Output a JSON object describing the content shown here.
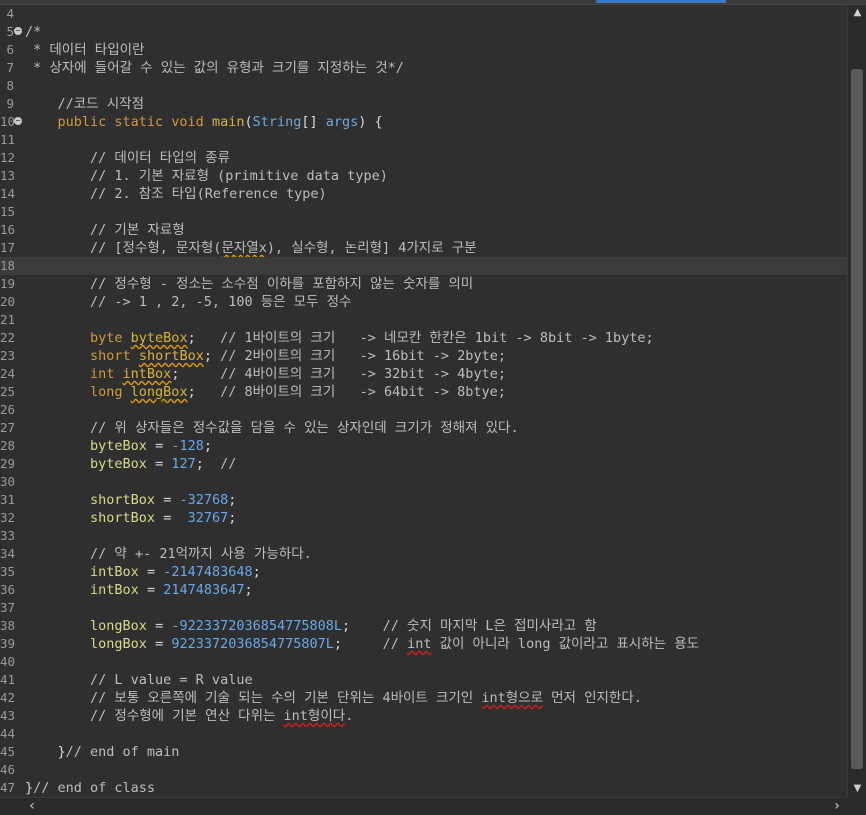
{
  "editor": {
    "current_line": 18,
    "colors": {
      "background": "#2f2f2f",
      "keyword": "#d19a3a",
      "type": "#6fa8d8",
      "method": "#d7b33d",
      "number": "#6aa8e8",
      "comment": "#bdbdbd",
      "current_line": "#3b3b3b"
    },
    "lines": [
      {
        "n": "4",
        "segments": []
      },
      {
        "n": "5",
        "fold": true,
        "segments": [
          {
            "t": "/*",
            "c": "comment"
          }
        ]
      },
      {
        "n": "6",
        "segments": [
          {
            "t": " * 데이터 타입이란",
            "c": "comment"
          }
        ]
      },
      {
        "n": "7",
        "segments": [
          {
            "t": " * 상자에 들어갈 수 있는 값의 유형과 크기를 지정하는 것*/",
            "c": "comment"
          }
        ]
      },
      {
        "n": "8",
        "segments": []
      },
      {
        "n": "9",
        "segments": [
          {
            "t": "    //코드 시작점",
            "c": "comment"
          }
        ]
      },
      {
        "n": "10",
        "fold": true,
        "segments": [
          {
            "t": "    ",
            "c": "plain"
          },
          {
            "t": "public static void ",
            "c": "kw"
          },
          {
            "t": "main",
            "c": "method"
          },
          {
            "t": "(",
            "c": "plain"
          },
          {
            "t": "String",
            "c": "type"
          },
          {
            "t": "[] ",
            "c": "plain"
          },
          {
            "t": "args",
            "c": "type"
          },
          {
            "t": ") {",
            "c": "plain"
          }
        ]
      },
      {
        "n": "11",
        "segments": []
      },
      {
        "n": "12",
        "segments": [
          {
            "t": "        // 데이터 타입의 종류",
            "c": "comment"
          }
        ]
      },
      {
        "n": "13",
        "segments": [
          {
            "t": "        // 1. 기본 자료형 (primitive data type)",
            "c": "comment"
          }
        ]
      },
      {
        "n": "14",
        "segments": [
          {
            "t": "        // 2. 참조 타입(Reference type)",
            "c": "comment"
          }
        ]
      },
      {
        "n": "15",
        "segments": []
      },
      {
        "n": "16",
        "segments": [
          {
            "t": "        // 기본 자료형",
            "c": "comment"
          }
        ]
      },
      {
        "n": "17",
        "segments": [
          {
            "t": "        // [정수형, 문자형(",
            "c": "comment"
          },
          {
            "t": "문자열x",
            "c": "comment squiggle"
          },
          {
            "t": "), 실수형, 논리형] 4가지로 구분",
            "c": "comment"
          }
        ]
      },
      {
        "n": "18",
        "segments": []
      },
      {
        "n": "19",
        "segments": [
          {
            "t": "        // 정수형 - 정소는 소수점 이하를 포함하지 않는 숫자를 의미",
            "c": "comment"
          }
        ]
      },
      {
        "n": "20",
        "segments": [
          {
            "t": "        // -> 1 , 2, -5, 100 등은 모두 정수",
            "c": "comment"
          }
        ]
      },
      {
        "n": "21",
        "segments": []
      },
      {
        "n": "22",
        "segments": [
          {
            "t": "        ",
            "c": "plain"
          },
          {
            "t": "byte ",
            "c": "kw"
          },
          {
            "t": "byteBox",
            "c": "method squiggle"
          },
          {
            "t": ";   ",
            "c": "plain"
          },
          {
            "t": "// 1바이트의 크기   -> 네모칸 한칸은 1bit -> 8bit -> 1byte;",
            "c": "comment"
          }
        ]
      },
      {
        "n": "23",
        "segments": [
          {
            "t": "        ",
            "c": "plain"
          },
          {
            "t": "short ",
            "c": "kw"
          },
          {
            "t": "shortBox",
            "c": "method squiggle"
          },
          {
            "t": "; ",
            "c": "plain"
          },
          {
            "t": "// 2바이트의 크기   -> 16bit -> 2byte;",
            "c": "comment"
          }
        ]
      },
      {
        "n": "24",
        "segments": [
          {
            "t": "        ",
            "c": "plain"
          },
          {
            "t": "int ",
            "c": "kw"
          },
          {
            "t": "intBox",
            "c": "method squiggle"
          },
          {
            "t": ";     ",
            "c": "plain"
          },
          {
            "t": "// 4바이트의 크기   -> 32bit -> 4byte;",
            "c": "comment"
          }
        ]
      },
      {
        "n": "25",
        "segments": [
          {
            "t": "        ",
            "c": "plain"
          },
          {
            "t": "long ",
            "c": "kw"
          },
          {
            "t": "longBox",
            "c": "method squiggle"
          },
          {
            "t": ";   ",
            "c": "plain"
          },
          {
            "t": "// 8바이트의 크기   -> 64bit -> 8btye;",
            "c": "comment"
          }
        ]
      },
      {
        "n": "26",
        "segments": []
      },
      {
        "n": "27",
        "segments": [
          {
            "t": "        // 위 상자들은 정수값을 담을 수 있는 상자인데 크기가 정해져 있다.",
            "c": "comment"
          }
        ]
      },
      {
        "n": "28",
        "segments": [
          {
            "t": "        ",
            "c": "plain"
          },
          {
            "t": "byteBox",
            "c": "ident-field"
          },
          {
            "t": " = ",
            "c": "plain"
          },
          {
            "t": "-128",
            "c": "num"
          },
          {
            "t": ";",
            "c": "plain"
          }
        ]
      },
      {
        "n": "29",
        "segments": [
          {
            "t": "        ",
            "c": "plain"
          },
          {
            "t": "byteBox",
            "c": "ident-field"
          },
          {
            "t": " = ",
            "c": "plain"
          },
          {
            "t": "127",
            "c": "num"
          },
          {
            "t": ";  ",
            "c": "plain"
          },
          {
            "t": "//",
            "c": "comment"
          }
        ]
      },
      {
        "n": "30",
        "segments": []
      },
      {
        "n": "31",
        "segments": [
          {
            "t": "        ",
            "c": "plain"
          },
          {
            "t": "shortBox",
            "c": "ident-field"
          },
          {
            "t": " = ",
            "c": "plain"
          },
          {
            "t": "-32768",
            "c": "num"
          },
          {
            "t": ";",
            "c": "plain"
          }
        ]
      },
      {
        "n": "32",
        "segments": [
          {
            "t": "        ",
            "c": "plain"
          },
          {
            "t": "shortBox",
            "c": "ident-field"
          },
          {
            "t": " =  ",
            "c": "plain"
          },
          {
            "t": "32767",
            "c": "num"
          },
          {
            "t": ";",
            "c": "plain"
          }
        ]
      },
      {
        "n": "33",
        "segments": []
      },
      {
        "n": "34",
        "segments": [
          {
            "t": "        // 약 +- 21억까지 사용 가능하다.",
            "c": "comment"
          }
        ]
      },
      {
        "n": "35",
        "segments": [
          {
            "t": "        ",
            "c": "plain"
          },
          {
            "t": "intBox",
            "c": "ident-field"
          },
          {
            "t": " = ",
            "c": "plain"
          },
          {
            "t": "-2147483648",
            "c": "num"
          },
          {
            "t": ";",
            "c": "plain"
          }
        ]
      },
      {
        "n": "36",
        "segments": [
          {
            "t": "        ",
            "c": "plain"
          },
          {
            "t": "intBox",
            "c": "ident-field"
          },
          {
            "t": " = ",
            "c": "plain"
          },
          {
            "t": "2147483647",
            "c": "num"
          },
          {
            "t": ";",
            "c": "plain"
          }
        ]
      },
      {
        "n": "37",
        "segments": []
      },
      {
        "n": "38",
        "segments": [
          {
            "t": "        ",
            "c": "plain"
          },
          {
            "t": "longBox",
            "c": "ident-field"
          },
          {
            "t": " = ",
            "c": "plain"
          },
          {
            "t": "-9223372036854775808L",
            "c": "num"
          },
          {
            "t": ";    ",
            "c": "plain"
          },
          {
            "t": "// 숫지 마지막 L은 접미사라고 함",
            "c": "comment"
          }
        ]
      },
      {
        "n": "39",
        "segments": [
          {
            "t": "        ",
            "c": "plain"
          },
          {
            "t": "longBox",
            "c": "ident-field"
          },
          {
            "t": " = ",
            "c": "plain"
          },
          {
            "t": "9223372036854775807L",
            "c": "num"
          },
          {
            "t": ";     ",
            "c": "plain"
          },
          {
            "t": "// ",
            "c": "comment"
          },
          {
            "t": "int",
            "c": "comment squiggle-red"
          },
          {
            "t": " 값이 아니라 long 값이라고 표시하는 용도",
            "c": "comment"
          }
        ]
      },
      {
        "n": "40",
        "segments": []
      },
      {
        "n": "41",
        "segments": [
          {
            "t": "        // L value = R value",
            "c": "comment"
          }
        ]
      },
      {
        "n": "42",
        "segments": [
          {
            "t": "        // 보통 오른쪽에 기술 되는 수의 기본 단위는 4바이트 크기인 ",
            "c": "comment"
          },
          {
            "t": "int형으로",
            "c": "comment squiggle-red"
          },
          {
            "t": " 먼저 인지한다.",
            "c": "comment"
          }
        ]
      },
      {
        "n": "43",
        "segments": [
          {
            "t": "        // 정수형에 기본 연산 다위는 ",
            "c": "comment"
          },
          {
            "t": "int형이다",
            "c": "comment squiggle-red"
          },
          {
            "t": ".",
            "c": "comment"
          }
        ]
      },
      {
        "n": "44",
        "segments": []
      },
      {
        "n": "45",
        "segments": [
          {
            "t": "    }",
            "c": "plain"
          },
          {
            "t": "// end of main",
            "c": "comment"
          }
        ]
      },
      {
        "n": "46",
        "segments": []
      },
      {
        "n": "47",
        "segments": [
          {
            "t": "}",
            "c": "plain"
          },
          {
            "t": "// end of class",
            "c": "comment"
          }
        ]
      }
    ]
  },
  "scrollbars": {
    "up_icon": "▲",
    "down_icon": "▼",
    "left_icon": "‹",
    "right_icon": "›"
  }
}
